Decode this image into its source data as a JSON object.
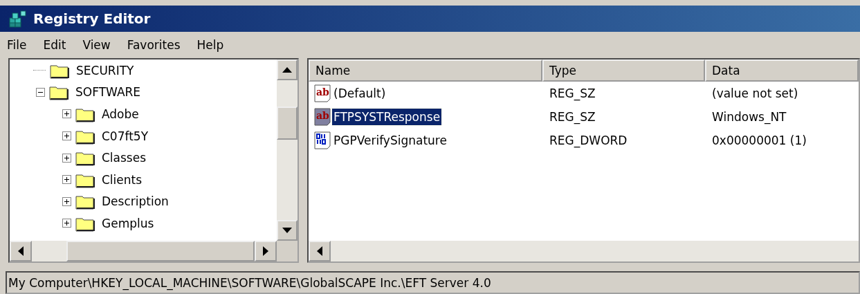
{
  "window": {
    "title": "Registry Editor"
  },
  "menu": [
    "File",
    "Edit",
    "View",
    "Favorites",
    "Help"
  ],
  "tree": [
    {
      "label": "SECURITY"
    },
    {
      "label": "SOFTWARE",
      "expanded": true,
      "children": [
        {
          "label": "Adobe",
          "expanded": false
        },
        {
          "label": "C07ft5Y",
          "expanded": false
        },
        {
          "label": "Classes",
          "expanded": false
        },
        {
          "label": "Clients",
          "expanded": false
        },
        {
          "label": "Description",
          "expanded": false
        },
        {
          "label": "Gemplus",
          "expanded": false
        }
      ]
    }
  ],
  "table": {
    "columns": [
      "Name",
      "Type",
      "Data"
    ],
    "rows": [
      {
        "kind": "string",
        "icon": "ab",
        "name": "(Default)",
        "type": "REG_SZ",
        "data": "(value not set)",
        "selected": false
      },
      {
        "kind": "string",
        "icon": "ab",
        "name": "FTPSYSTResponse",
        "type": "REG_SZ",
        "data": "Windows_NT",
        "selected": true
      },
      {
        "kind": "dword",
        "name": "PGPVerifySignature",
        "type": "REG_DWORD",
        "data": "0x00000001 (1)",
        "selected": false
      }
    ]
  },
  "status_bar": "My Computer\\HKEY_LOCAL_MACHINE\\SOFTWARE\\GlobalSCAPE Inc.\\EFT Server 4.0"
}
